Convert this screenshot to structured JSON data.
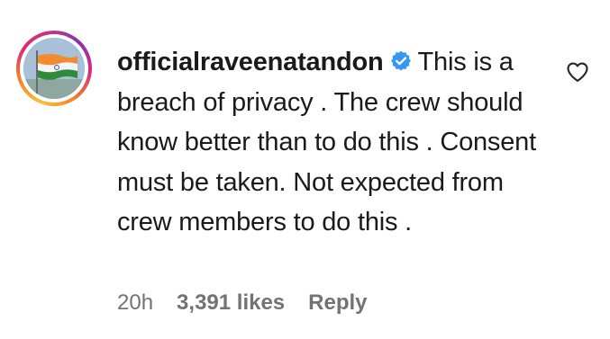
{
  "comment": {
    "username": "officialraveenatandon",
    "verified_icon": "verified-badge-icon",
    "text": "This is a breach of privacy . The crew should know better than to do this . Consent must be taken. Not expected from crew members to do this .",
    "avatar": "india-flag-avatar",
    "time": "20h",
    "likes": "3,391 likes",
    "reply_label": "Reply",
    "like_icon": "heart-outline-icon"
  },
  "colors": {
    "text": "#1a1a1a",
    "meta_text": "#737373",
    "verified_blue": "#3897f0",
    "ring_start": "#f9c13a",
    "ring_end": "#c13584"
  }
}
